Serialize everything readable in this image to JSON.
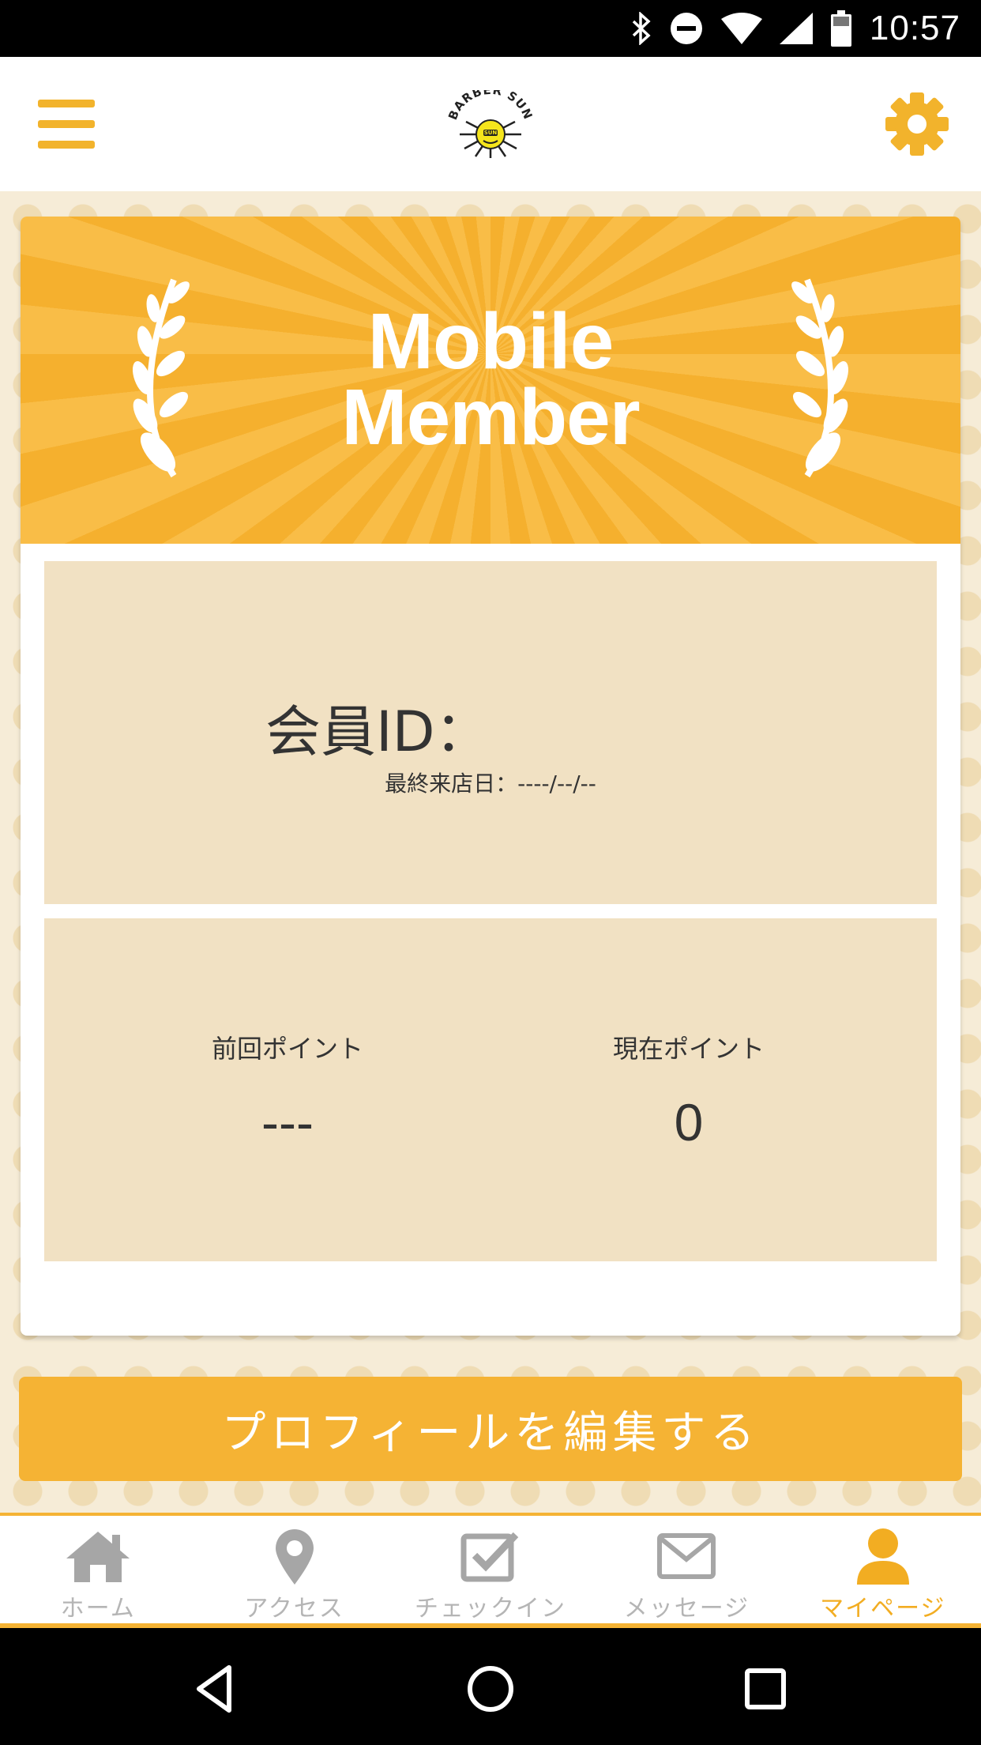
{
  "status_bar": {
    "time": "10:57",
    "icons": [
      "bluetooth-icon",
      "do-not-disturb-icon",
      "wifi-icon",
      "signal-icon",
      "battery-icon"
    ]
  },
  "header": {
    "menu_icon": "hamburger-menu-icon",
    "logo_text": "BARBER SUN",
    "logo_inner": "SUN",
    "settings_icon": "gear-icon"
  },
  "card": {
    "banner_line1": "Mobile",
    "banner_line2": "Member",
    "member_id_label": "会員ID：",
    "last_visit": "最終来店日：----/--/--",
    "previous_points_label": "前回ポイント",
    "previous_points_value": "---",
    "current_points_label": "現在ポイント",
    "current_points_value": "0"
  },
  "edit_profile_label": "プロフィールを編集する",
  "bottom_nav": {
    "items": [
      {
        "label": "ホーム",
        "icon": "home-icon"
      },
      {
        "label": "アクセス",
        "icon": "map-pin-icon"
      },
      {
        "label": "チェックイン",
        "icon": "checkbox-icon"
      },
      {
        "label": "メッセージ",
        "icon": "mail-icon"
      },
      {
        "label": "マイページ",
        "icon": "user-icon"
      }
    ],
    "active": "マイページ"
  },
  "colors": {
    "accent": "#f5b334",
    "panel": "#f1e1c3",
    "inactive_nav": "#b5b5b5"
  }
}
